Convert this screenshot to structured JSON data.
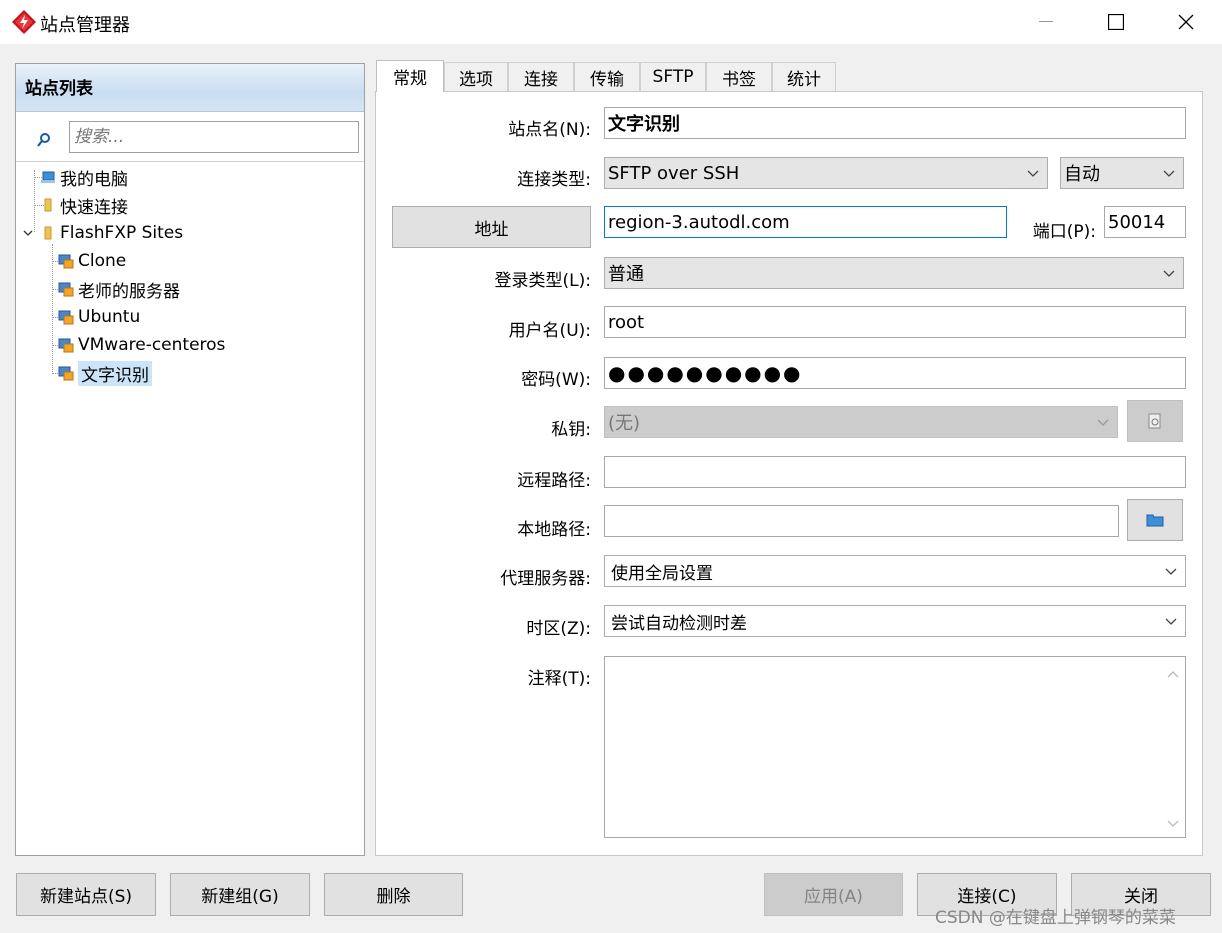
{
  "window": {
    "title": "站点管理器"
  },
  "site_list": {
    "header": "站点列表",
    "search_placeholder": "搜索...",
    "tree": [
      {
        "label": "我的电脑",
        "icon": "computer-icon",
        "level": 0
      },
      {
        "label": "快速连接",
        "icon": "folder-icon",
        "level": 0
      },
      {
        "label": "FlashFXP Sites",
        "icon": "folder-icon",
        "level": 0,
        "expanded": true
      },
      {
        "label": "Clone",
        "icon": "site-icon",
        "level": 1
      },
      {
        "label": "老师的服务器",
        "icon": "site-icon",
        "level": 1
      },
      {
        "label": "Ubuntu",
        "icon": "site-icon",
        "level": 1
      },
      {
        "label": "VMware-centeros",
        "icon": "site-icon",
        "level": 1
      },
      {
        "label": "文字识别",
        "icon": "site-icon",
        "level": 1,
        "selected": true
      }
    ]
  },
  "tabs": [
    "常规",
    "选项",
    "连接",
    "传输",
    "SFTP",
    "书签",
    "统计"
  ],
  "form": {
    "site_name_label": "站点名(N):",
    "site_name_value": "文字识别",
    "conn_type_label": "连接类型:",
    "conn_type_value": "SFTP over SSH",
    "conn_mode_value": "自动",
    "address_button": "地址",
    "address_value": "region-3.autodl.com",
    "port_label": "端口(P):",
    "port_value": "50014",
    "login_type_label": "登录类型(L):",
    "login_type_value": "普通",
    "username_label": "用户名(U):",
    "username_value": "root",
    "password_label": "密码(W):",
    "password_value": "●●●●●●●●●●",
    "private_key_label": "私钥:",
    "private_key_value": "(无)",
    "remote_path_label": "远程路径:",
    "remote_path_value": "",
    "local_path_label": "本地路径:",
    "local_path_value": "",
    "proxy_label": "代理服务器:",
    "proxy_value": "使用全局设置",
    "timezone_label": "时区(Z):",
    "timezone_value": "尝试自动检测时差",
    "notes_label": "注释(T):",
    "notes_value": ""
  },
  "buttons": {
    "new_site": "新建站点(S)",
    "new_group": "新建组(G)",
    "delete": "删除",
    "apply": "应用(A)",
    "connect": "连接(C)",
    "close": "关闭"
  },
  "watermark": "CSDN @在键盘上弹钢琴的菜菜"
}
